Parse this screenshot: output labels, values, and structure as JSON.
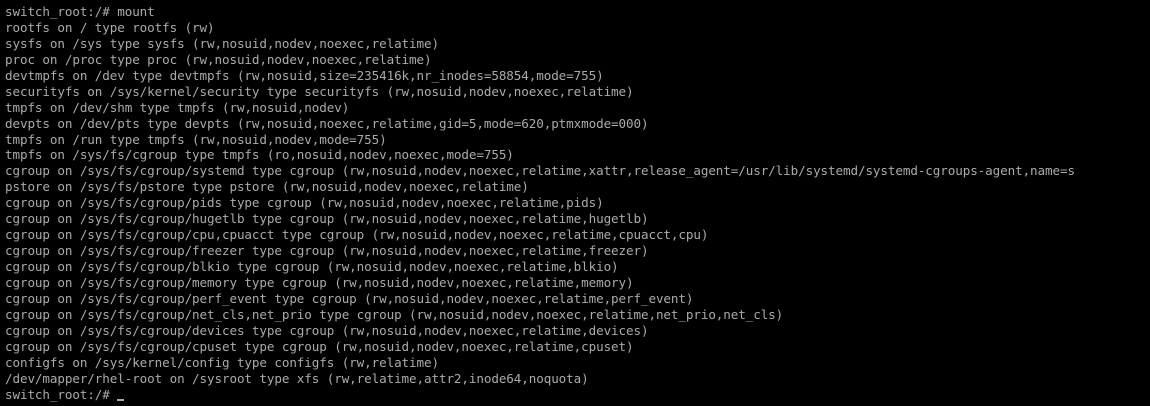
{
  "terminal": {
    "colors": {
      "background": "#000000",
      "foreground": "#aaaaaa"
    },
    "first_prompt": "switch_root:/# ",
    "command": "mount",
    "output_lines": [
      "rootfs on / type rootfs (rw)",
      "sysfs on /sys type sysfs (rw,nosuid,nodev,noexec,relatime)",
      "proc on /proc type proc (rw,nosuid,nodev,noexec,relatime)",
      "devtmpfs on /dev type devtmpfs (rw,nosuid,size=235416k,nr_inodes=58854,mode=755)",
      "securityfs on /sys/kernel/security type securityfs (rw,nosuid,nodev,noexec,relatime)",
      "tmpfs on /dev/shm type tmpfs (rw,nosuid,nodev)",
      "devpts on /dev/pts type devpts (rw,nosuid,noexec,relatime,gid=5,mode=620,ptmxmode=000)",
      "tmpfs on /run type tmpfs (rw,nosuid,nodev,mode=755)",
      "tmpfs on /sys/fs/cgroup type tmpfs (ro,nosuid,nodev,noexec,mode=755)",
      "cgroup on /sys/fs/cgroup/systemd type cgroup (rw,nosuid,nodev,noexec,relatime,xattr,release_agent=/usr/lib/systemd/systemd-cgroups-agent,name=s",
      "pstore on /sys/fs/pstore type pstore (rw,nosuid,nodev,noexec,relatime)",
      "cgroup on /sys/fs/cgroup/pids type cgroup (rw,nosuid,nodev,noexec,relatime,pids)",
      "cgroup on /sys/fs/cgroup/hugetlb type cgroup (rw,nosuid,nodev,noexec,relatime,hugetlb)",
      "cgroup on /sys/fs/cgroup/cpu,cpuacct type cgroup (rw,nosuid,nodev,noexec,relatime,cpuacct,cpu)",
      "cgroup on /sys/fs/cgroup/freezer type cgroup (rw,nosuid,nodev,noexec,relatime,freezer)",
      "cgroup on /sys/fs/cgroup/blkio type cgroup (rw,nosuid,nodev,noexec,relatime,blkio)",
      "cgroup on /sys/fs/cgroup/memory type cgroup (rw,nosuid,nodev,noexec,relatime,memory)",
      "cgroup on /sys/fs/cgroup/perf_event type cgroup (rw,nosuid,nodev,noexec,relatime,perf_event)",
      "cgroup on /sys/fs/cgroup/net_cls,net_prio type cgroup (rw,nosuid,nodev,noexec,relatime,net_prio,net_cls)",
      "cgroup on /sys/fs/cgroup/devices type cgroup (rw,nosuid,nodev,noexec,relatime,devices)",
      "cgroup on /sys/fs/cgroup/cpuset type cgroup (rw,nosuid,nodev,noexec,relatime,cpuset)",
      "configfs on /sys/kernel/config type configfs (rw,relatime)",
      "/dev/mapper/rhel-root on /sysroot type xfs (rw,relatime,attr2,inode64,noquota)"
    ],
    "final_prompt": "switch_root:/# "
  }
}
